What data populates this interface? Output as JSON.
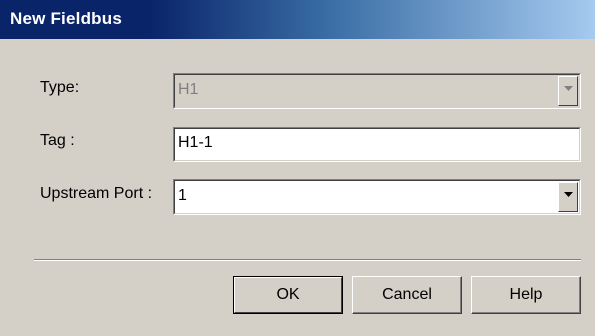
{
  "dialog": {
    "title": "New Fieldbus",
    "type": {
      "label": "Type:",
      "value": "H1"
    },
    "tag": {
      "label": "Tag :",
      "value": "H1-1"
    },
    "upstream_port": {
      "label": "Upstream Port :",
      "value": "1"
    },
    "buttons": {
      "ok": "OK",
      "cancel": "Cancel",
      "help": "Help"
    }
  },
  "colors": {
    "titlebar_start": "#0a246a",
    "titlebar_end": "#a6caf0",
    "face": "#d4d0c8",
    "disabled_text": "#808080"
  },
  "icons": {
    "dropdown": "chevron-down-icon"
  }
}
